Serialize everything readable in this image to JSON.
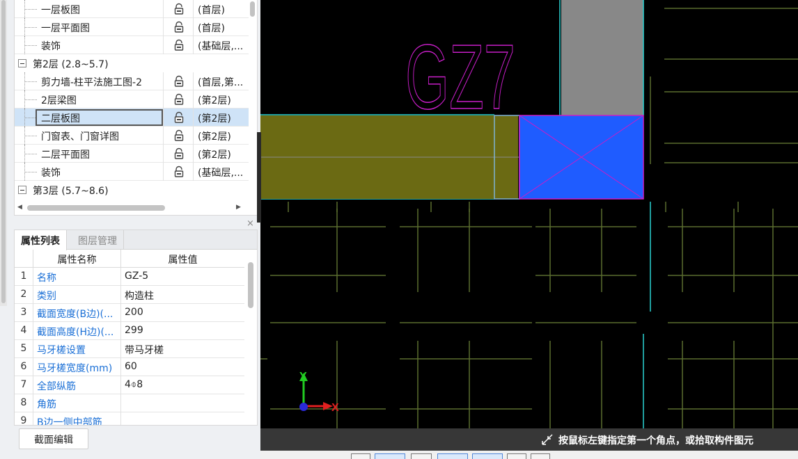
{
  "tree": {
    "rows": [
      {
        "kind": "item",
        "name": "一层板图",
        "layer": "(首层)"
      },
      {
        "kind": "item",
        "name": "一层平面图",
        "layer": "(首层)"
      },
      {
        "kind": "item",
        "name": "装饰",
        "layer": "(基础层,..."
      },
      {
        "kind": "group",
        "name": "第2层 (2.8~5.7)"
      },
      {
        "kind": "item",
        "name": "剪力墙-柱平法施工图-2",
        "layer": "(首层,第..."
      },
      {
        "kind": "item",
        "name": "2层梁图",
        "layer": "(第2层)"
      },
      {
        "kind": "item",
        "name": "二层板图",
        "layer": "(第2层)",
        "selected": true
      },
      {
        "kind": "item",
        "name": "门窗表、门窗详图",
        "layer": "(第2层)"
      },
      {
        "kind": "item",
        "name": "二层平面图",
        "layer": "(第2层)"
      },
      {
        "kind": "item",
        "name": "装饰",
        "layer": "(基础层,..."
      },
      {
        "kind": "group",
        "name": "第3层 (5.7~8.6)"
      }
    ],
    "icons": {
      "lock": "lock-icon",
      "expander": "collapse-minus-icon"
    }
  },
  "properties": {
    "tabs": [
      "属性列表",
      "图层管理"
    ],
    "header_name": "属性名称",
    "header_value": "属性值",
    "rows": [
      {
        "index": "1",
        "name": "名称",
        "value": "GZ-5"
      },
      {
        "index": "2",
        "name": "类别",
        "value": "构造柱"
      },
      {
        "index": "3",
        "name": "截面宽度(B边)(...",
        "value": "200"
      },
      {
        "index": "4",
        "name": "截面高度(H边)(...",
        "value": "299"
      },
      {
        "index": "5",
        "name": "马牙槎设置",
        "value": "带马牙槎"
      },
      {
        "index": "6",
        "name": "马牙槎宽度(mm)",
        "value": "60"
      },
      {
        "index": "7",
        "name": "全部纵筋",
        "value": "4⌽8"
      },
      {
        "index": "8",
        "name": "角筋",
        "value": ""
      },
      {
        "index": "9",
        "name": "B边一侧中部筋",
        "value": ""
      }
    ],
    "edit_button": "截面编辑",
    "close_glyph": "×"
  },
  "canvas": {
    "label_text": "GZ7",
    "axis_x": "X",
    "axis_y": "Y",
    "status_text": "按鼠标左键指定第一个角点，或拾取构件图元",
    "colors": {
      "background": "#000000",
      "wall_fill": "#6b6a13",
      "column_fill": "#1f5cff",
      "cyan_line": "#2ad2d2",
      "magenta": "#c81ec8",
      "gray_block": "#888888",
      "rebar_line": "#5b6e2f"
    }
  }
}
